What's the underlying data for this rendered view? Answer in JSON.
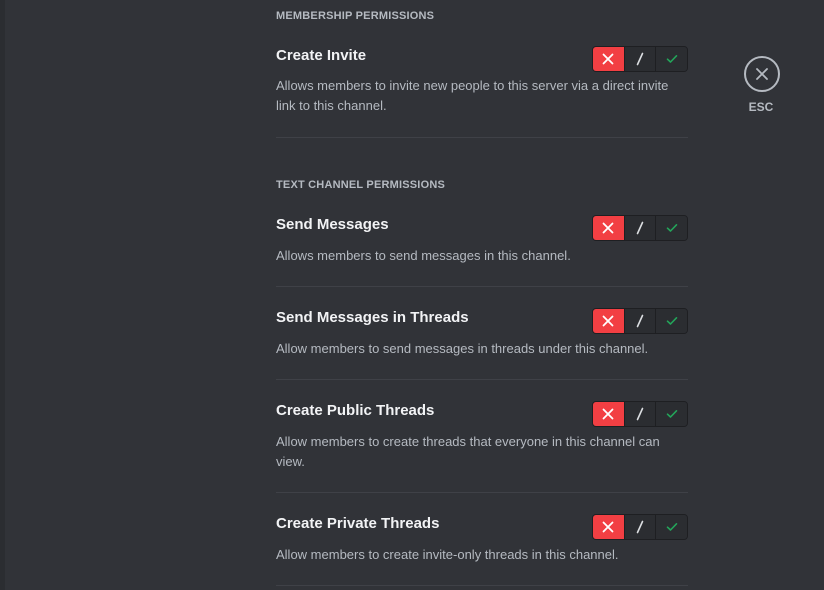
{
  "sections": {
    "membership": {
      "header": "MEMBERSHIP PERMISSIONS",
      "create_invite": {
        "title": "Create Invite",
        "desc": "Allows members to invite new people to this server via a direct invite link to this channel.",
        "state": "deny"
      }
    },
    "text_channel": {
      "header": "TEXT CHANNEL PERMISSIONS",
      "send_messages": {
        "title": "Send Messages",
        "desc": "Allows members to send messages in this channel.",
        "state": "deny"
      },
      "send_in_threads": {
        "title": "Send Messages in Threads",
        "desc": "Allow members to send messages in threads under this channel.",
        "state": "deny"
      },
      "create_public_threads": {
        "title": "Create Public Threads",
        "desc": "Allow members to create threads that everyone in this channel can view.",
        "state": "deny"
      },
      "create_private_threads": {
        "title": "Create Private Threads",
        "desc": "Allow members to create invite-only threads in this channel.",
        "state": "deny"
      }
    }
  },
  "toggle": {
    "neutral_glyph": "/",
    "icons": [
      "close-icon",
      "slash-icon",
      "check-icon"
    ]
  },
  "esc": {
    "label": "ESC",
    "icon": "close-icon"
  },
  "colors": {
    "background": "#313338",
    "deny": "#f23f43",
    "allow_check": "#23a55a",
    "text_primary": "#f2f3f5",
    "text_muted": "#b5bac1",
    "divider": "#3f4147"
  }
}
